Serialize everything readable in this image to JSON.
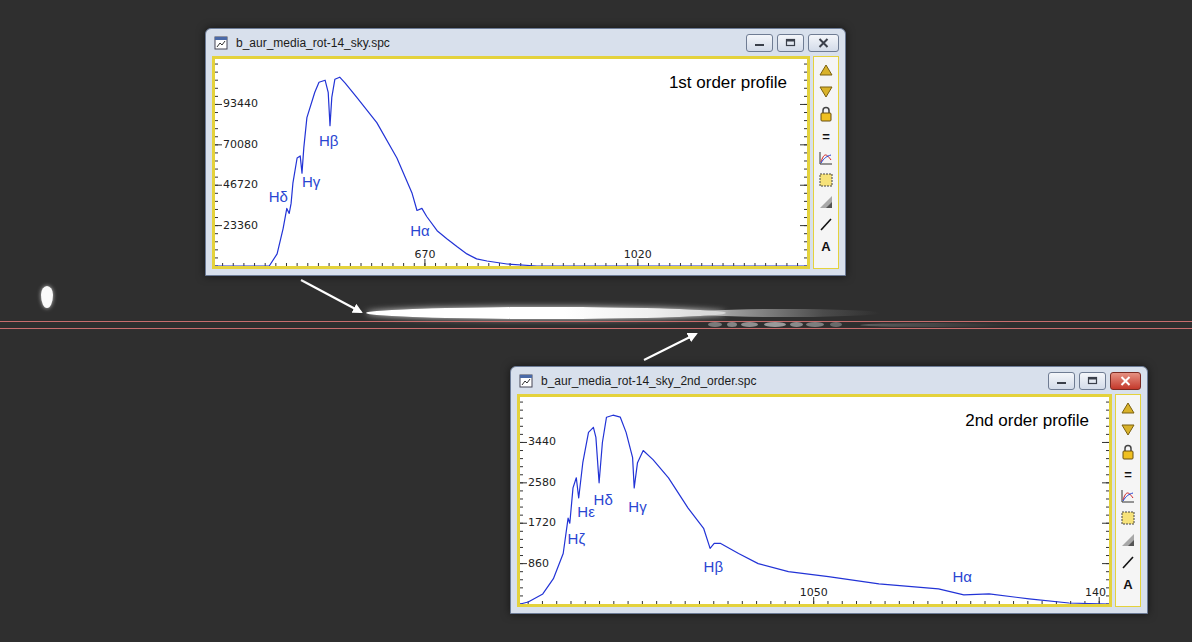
{
  "windows": [
    {
      "title": "b_aur_media_rot-14_sky.spc",
      "active": false,
      "chart": {
        "label": "1st order profile",
        "x_range": [
          325,
          1298
        ],
        "y_range": [
          0,
          119720
        ],
        "y_ticks": [
          {
            "label": "93440",
            "value": 93440
          },
          {
            "label": "70080",
            "value": 70080
          },
          {
            "label": "46720",
            "value": 46720
          },
          {
            "label": "23360",
            "value": 23360
          }
        ],
        "x_ticks": [
          {
            "label": "670",
            "value": 670
          },
          {
            "label": "1020",
            "value": 1020
          }
        ],
        "series": [
          {
            "x": [
              325,
              414,
              427,
              437,
              443,
              447,
              450,
              453,
              460,
              465,
              468,
              471,
              476,
              489,
              496,
              506,
              511,
              514,
              517,
              522,
              530,
              539,
              558,
              591,
              624,
              649,
              657,
              665,
              673,
              690,
              706,
              723,
              739,
              755,
              772,
              805,
              854,
              1298
            ],
            "values": [
              0,
              0,
              7008,
              21608,
              33288,
              30368,
              36208,
              47888,
              62488,
              63656,
              53728,
              68328,
              85848,
              100448,
              106288,
              107456,
              100448,
              81176,
              97528,
              108040,
              109208,
              105704,
              97528,
              82928,
              62488,
              42048,
              32120,
              33288,
              28616,
              20440,
              15768,
              11096,
              7008,
              4088,
              2920,
              1168,
              0,
              0
            ]
          }
        ],
        "annotations": [
          {
            "label": "Hδ",
            "x": 429,
            "y": 39712
          },
          {
            "label": "Hγ",
            "x": 483,
            "y": 48472
          },
          {
            "label": "Hβ",
            "x": 512,
            "y": 72416
          },
          {
            "label": "Hα",
            "x": 662,
            "y": 20440
          }
        ]
      },
      "toolbar": [
        {
          "kind": "up"
        },
        {
          "kind": "down"
        },
        {
          "kind": "lock"
        },
        {
          "kind": "text",
          "label": "="
        },
        {
          "kind": "chart"
        },
        {
          "kind": "select"
        },
        {
          "kind": "gradient"
        },
        {
          "kind": "line"
        },
        {
          "kind": "text",
          "label": "A"
        }
      ]
    },
    {
      "title": "b_aur_media_rot-14_sky_2nd_order.spc",
      "active": true,
      "chart": {
        "label": "2nd order profile",
        "x_range": [
          690,
          1412
        ],
        "y_range": [
          0,
          4408
        ],
        "y_ticks": [
          {
            "label": "3440",
            "value": 3440
          },
          {
            "label": "2580",
            "value": 2580
          },
          {
            "label": "1720",
            "value": 1720
          },
          {
            "label": "860",
            "value": 860
          }
        ],
        "x_ticks": [
          {
            "label": "1050",
            "value": 1050
          },
          {
            "label": "140",
            "value": 1400
          }
        ],
        "series": [
          {
            "x": [
              690,
              700,
              718,
              731,
              743,
              749,
              751,
              755,
              759,
              762,
              767,
              774,
              780,
              783,
              787,
              791,
              796,
              804,
              813,
              820,
              828,
              830,
              834,
              841,
              853,
              872,
              896,
              915,
              923,
              928,
              936,
              958,
              982,
              1019,
              1068,
              1130,
              1203,
              1234,
              1265,
              1314,
              1363,
              1412
            ],
            "values": [
              0,
              43,
              215,
              538,
              1075,
              1828,
              1720,
              2473,
              2688,
              2258,
              3010,
              3655,
              3763,
              3548,
              2580,
              3440,
              3978,
              4021,
              3978,
              3655,
              3118,
              2473,
              3010,
              3268,
              3075,
              2688,
              2043,
              1613,
              1183,
              1290,
              1290,
              1075,
              860,
              688,
              581,
              430,
              323,
              194,
              215,
              108,
              22,
              0
            ]
          }
        ],
        "annotations": [
          {
            "label": "Hζ",
            "x": 759,
            "y": 1376
          },
          {
            "label": "Hε",
            "x": 771,
            "y": 1957
          },
          {
            "label": "Hδ",
            "x": 792,
            "y": 2215
          },
          {
            "label": "Hγ",
            "x": 834,
            "y": 2064
          },
          {
            "label": "Hβ",
            "x": 927,
            "y": 796
          },
          {
            "label": "Hα",
            "x": 1232,
            "y": 581
          }
        ]
      },
      "toolbar": [
        {
          "kind": "up"
        },
        {
          "kind": "down"
        },
        {
          "kind": "lock"
        },
        {
          "kind": "text",
          "label": "="
        },
        {
          "kind": "chart"
        },
        {
          "kind": "select"
        },
        {
          "kind": "gradient"
        },
        {
          "kind": "line"
        },
        {
          "kind": "text",
          "label": "A"
        }
      ]
    }
  ]
}
